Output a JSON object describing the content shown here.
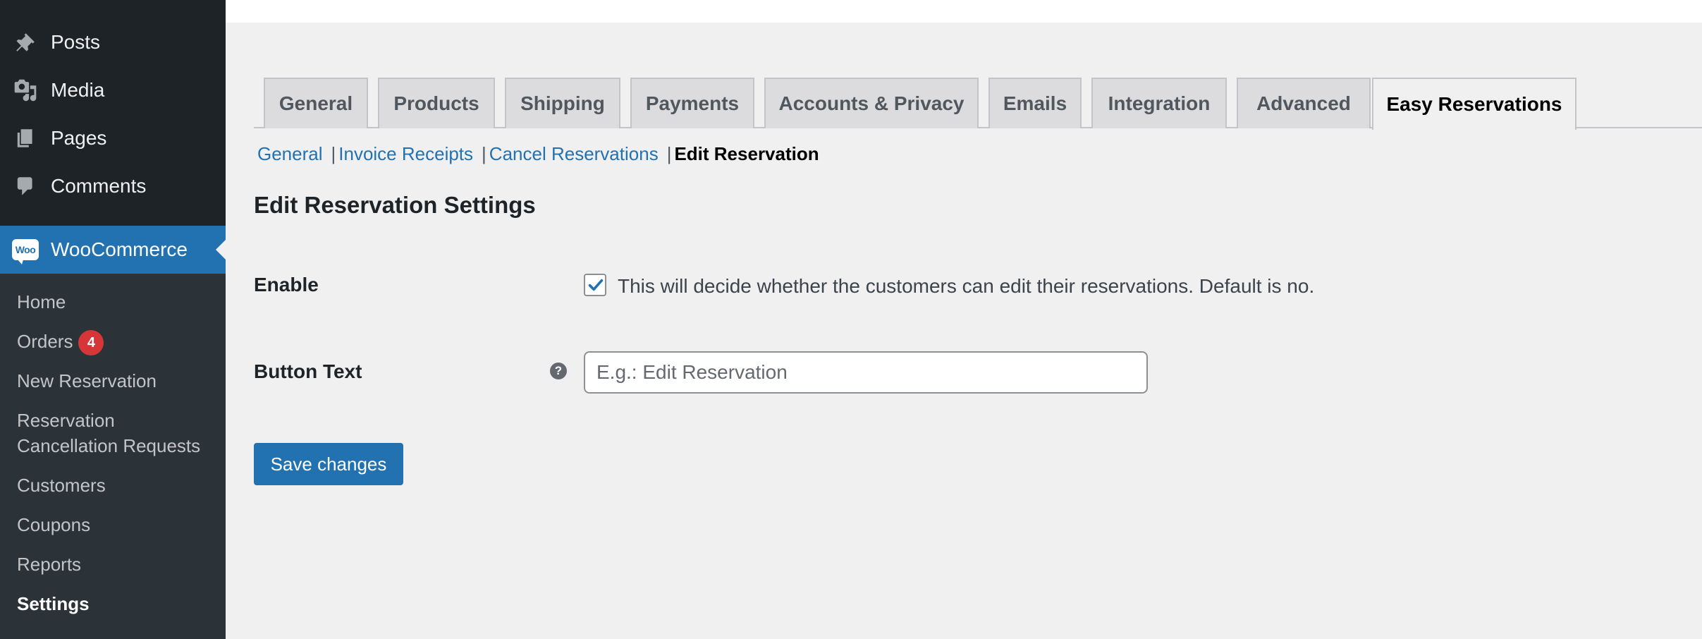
{
  "sidebar": {
    "top_items": [
      {
        "label": "Posts",
        "icon": "pushpin-icon"
      },
      {
        "label": "Media",
        "icon": "media-icon"
      },
      {
        "label": "Pages",
        "icon": "pages-icon"
      },
      {
        "label": "Comments",
        "icon": "comment-bubble-icon"
      }
    ],
    "active_item": {
      "label": "WooCommerce",
      "logo_text": "Woo"
    },
    "submenu": {
      "home": "Home",
      "orders": "Orders",
      "orders_badge": "4",
      "new_reservation": "New Reservation",
      "cancellation_line1": "Reservation",
      "cancellation_line2": "Cancellation Requests",
      "customers": "Customers",
      "coupons": "Coupons",
      "reports": "Reports",
      "settings": "Settings"
    }
  },
  "tabs": [
    {
      "label": "General"
    },
    {
      "label": "Products"
    },
    {
      "label": "Shipping"
    },
    {
      "label": "Payments"
    },
    {
      "label": "Accounts & Privacy"
    },
    {
      "label": "Emails"
    },
    {
      "label": "Integration"
    },
    {
      "label": "Advanced"
    },
    {
      "label": "Easy Reservations",
      "active": true
    }
  ],
  "subnav": {
    "general": "General",
    "invoice_receipts": "Invoice Receipts",
    "cancel_reservations": "Cancel Reservations",
    "edit_reservation": "Edit Reservation",
    "separator": "|"
  },
  "page": {
    "heading": "Edit Reservation Settings",
    "enable_label": "Enable",
    "enable_checked": true,
    "enable_description": "This will decide whether the customers can edit their reservations. Default is no.",
    "button_text_label": "Button Text",
    "help_glyph": "?",
    "button_text_value": "",
    "button_text_placeholder": "E.g.: Edit Reservation",
    "save_label": "Save changes"
  },
  "colors": {
    "admin_bar": "#1d2327",
    "submenu_bg": "#2c3338",
    "accent": "#2271b1",
    "badge": "#d63638",
    "content_bg": "#f0f0f1"
  }
}
